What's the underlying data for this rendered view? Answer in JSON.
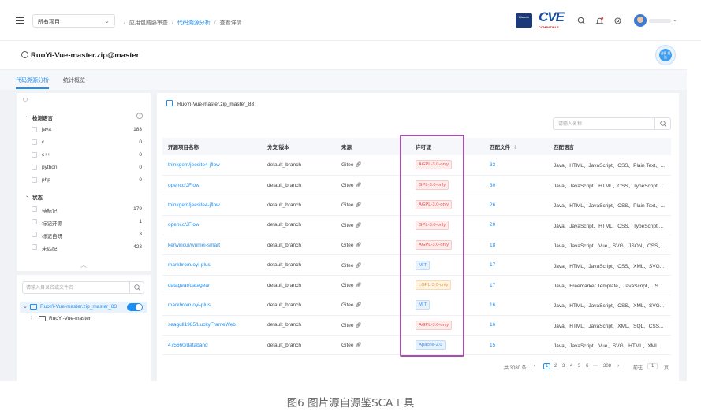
{
  "topbar": {
    "project_select": "所有项目",
    "breadcrumb": [
      "应用包威胁审查",
      "代码溯源分析",
      "查看详情"
    ],
    "logo_q_text": "Qiaoxin",
    "logo_cve_text": "CVE",
    "logo_cve_sub": "COMPATIBLE"
  },
  "page": {
    "title": "RuoYi-Vue-master.zip@master",
    "fab_label": "详情 报告"
  },
  "tabs": [
    {
      "label": "代码溯源分析",
      "active": true
    },
    {
      "label": "统计概览",
      "active": false
    }
  ],
  "filter": {
    "languages_title": "检测语言",
    "languages": [
      {
        "label": "java",
        "count": "183"
      },
      {
        "label": "c",
        "count": "0"
      },
      {
        "label": "c++",
        "count": "0"
      },
      {
        "label": "python",
        "count": "0"
      },
      {
        "label": "php",
        "count": "0"
      }
    ],
    "status_title": "状态",
    "statuses": [
      {
        "label": "待标记",
        "count": "179"
      },
      {
        "label": "标记开源",
        "count": "1"
      },
      {
        "label": "标记自研",
        "count": "3"
      },
      {
        "label": "未匹配",
        "count": "423"
      }
    ]
  },
  "tree": {
    "search_placeholder": "请输入目录名或文件名",
    "root_label": "RuoYi-Vue-master.zip_master_83",
    "child_label": "RuoYi-Vue-master"
  },
  "results": {
    "project_label": "RuoYi-Vue-master.zip_master_83",
    "search_placeholder": "请输入名称",
    "columns": [
      "开源项目名称",
      "分支/版本",
      "来源",
      "许可证",
      "匹配文件",
      "匹配语言"
    ],
    "rows": [
      {
        "name": "thinkgem/jeesite4-jflow",
        "branch": "default_branch",
        "source": "Gitee",
        "license": "AGPL-3.0-only",
        "license_color": "red",
        "files": "33",
        "langs": "Java、HTML、JavaScript、CSS、Plain Text、..."
      },
      {
        "name": "opencc/JFlow",
        "branch": "default_branch",
        "source": "Gitee",
        "license": "GPL-3.0-only",
        "license_color": "red",
        "files": "30",
        "langs": "Java、JavaScript、HTML、CSS、TypeScript ..."
      },
      {
        "name": "thinkgem/jeesite4-jflow",
        "branch": "default_branch",
        "source": "Gitee",
        "license": "AGPL-3.0-only",
        "license_color": "red",
        "files": "26",
        "langs": "Java、HTML、JavaScript、CSS、Plain Text、..."
      },
      {
        "name": "opencc/JFlow",
        "branch": "default_branch",
        "source": "Gitee",
        "license": "GPL-3.0-only",
        "license_color": "red",
        "files": "20",
        "langs": "Java、JavaScript、HTML、CSS、TypeScript ..."
      },
      {
        "name": "kerwincui/wumei-smart",
        "branch": "default_branch",
        "source": "Gitee",
        "license": "AGPL-3.0-only",
        "license_color": "red",
        "files": "18",
        "langs": "Java、JavaScript、Vue、SVG、JSON、CSS、..."
      },
      {
        "name": "markbro/ruoyi-plus",
        "branch": "default_branch",
        "source": "Gitee",
        "license": "MIT",
        "license_color": "blue",
        "files": "17",
        "langs": "Java、HTML、JavaScript、CSS、XML、SVG..."
      },
      {
        "name": "datagear/datagear",
        "branch": "default_branch",
        "source": "Gitee",
        "license": "LGPL-3.0-only",
        "license_color": "orange",
        "files": "17",
        "langs": "Java、Freemarker Template、JavaScript、JS..."
      },
      {
        "name": "markbro/ruoyi-plus",
        "branch": "default_branch",
        "source": "Gitee",
        "license": "MIT",
        "license_color": "blue",
        "files": "16",
        "langs": "Java、HTML、JavaScript、CSS、XML、SVG..."
      },
      {
        "name": "seagull1985/LuckyFrameWeb",
        "branch": "default_branch",
        "source": "Gitee",
        "license": "AGPL-3.0-only",
        "license_color": "red",
        "files": "16",
        "langs": "Java、HTML、JavaScript、XML、SQL、CSS..."
      },
      {
        "name": "475660/databand",
        "branch": "default_branch",
        "source": "Gitee",
        "license": "Apache-2.0",
        "license_color": "blue",
        "files": "15",
        "langs": "Java、JavaScript、Vue、SVG、HTML、XML..."
      }
    ]
  },
  "pagination": {
    "total": "共 3080 条",
    "pages": [
      "1",
      "2",
      "3",
      "4",
      "5",
      "6",
      "···",
      "308"
    ],
    "current": "1",
    "goto_label": "前往",
    "goto_value": "1",
    "page_suffix": "页"
  },
  "caption": "图6 图片源自源鉴SCA工具"
}
